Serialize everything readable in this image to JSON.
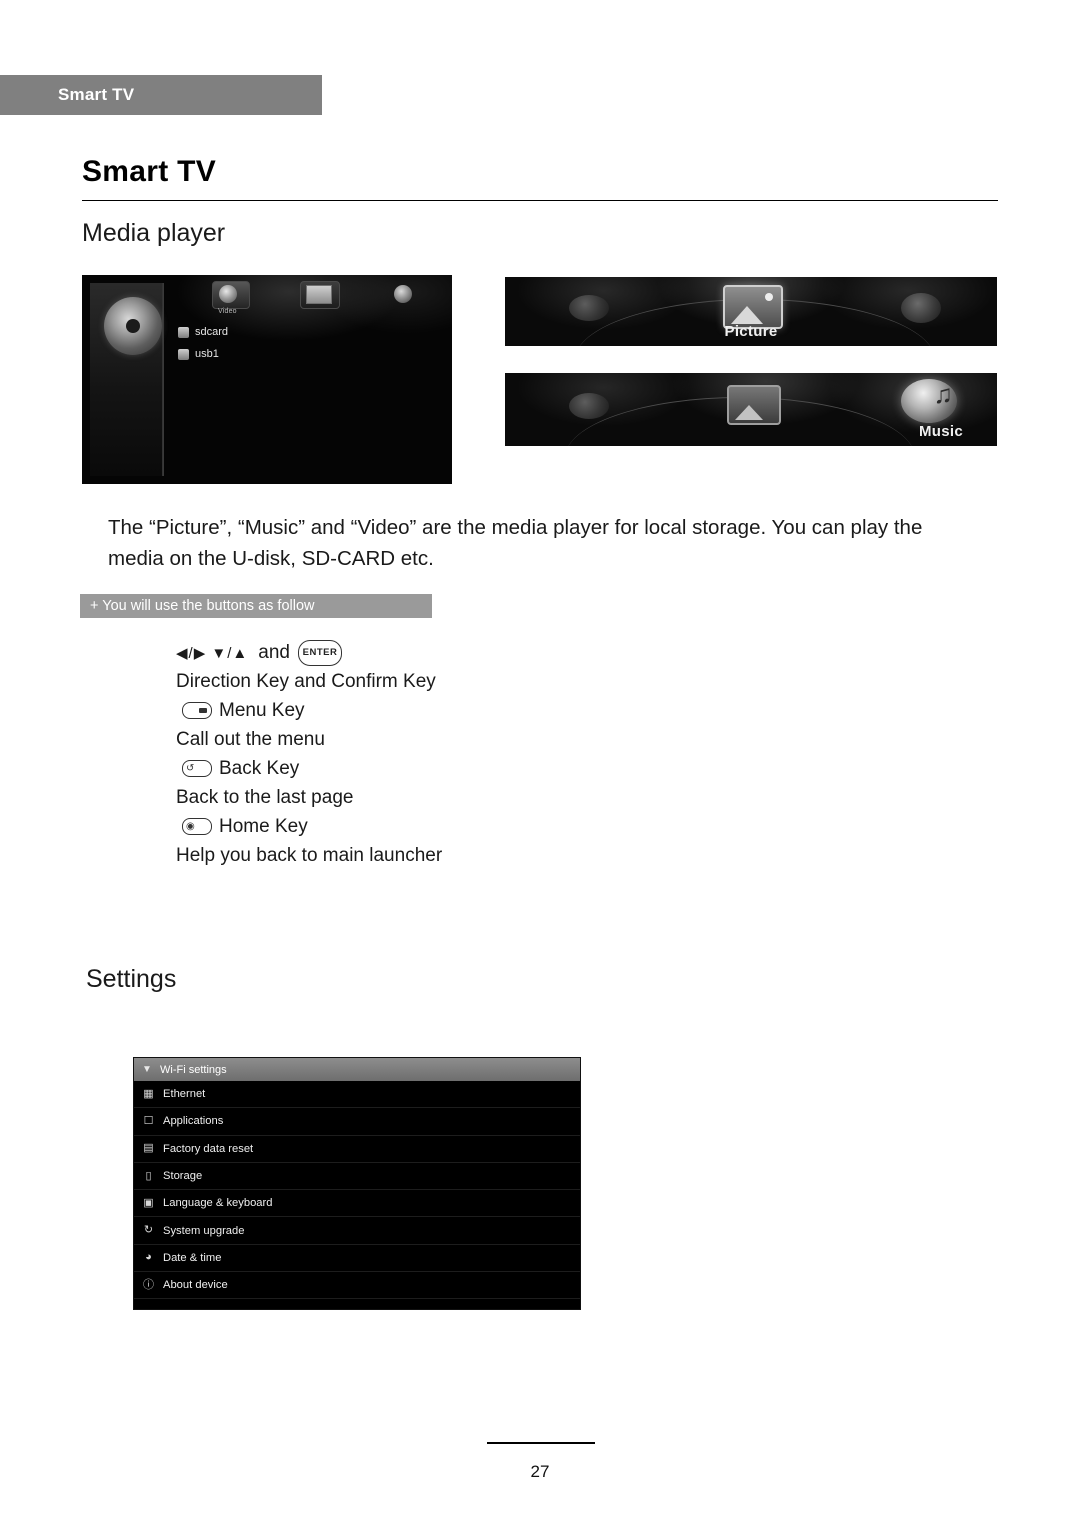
{
  "header": {
    "tab_label": "Smart TV"
  },
  "page_title": "Smart TV",
  "sections": {
    "media_player": {
      "heading": "Media player",
      "screenshots": {
        "video": {
          "tabs": [
            {
              "caption": "Video",
              "icon": "film-icon"
            },
            {
              "caption": "",
              "icon": "picture-icon"
            },
            {
              "caption": "",
              "icon": "music-icon"
            }
          ],
          "storage_items": [
            "sdcard",
            "usb1"
          ]
        },
        "picture": {
          "caption": "Picture"
        },
        "music": {
          "caption": "Music"
        }
      },
      "paragraph": "The “Picture”, “Music” and “Video” are the media player for local storage. You can play the media on the U-disk, SD-CARD etc.",
      "note_ribbon": "+ You will use the buttons as follow",
      "keys": [
        {
          "arrows": "◀/▶  ▼/▲",
          "and": "and",
          "button": "ENTER",
          "description": "Direction Key and Confirm Key"
        },
        {
          "button_icon": "menu-key-icon",
          "label": "Menu Key",
          "description": "Call out the menu"
        },
        {
          "button_icon": "back-key-icon",
          "label": "Back Key",
          "description": "Back to the last page"
        },
        {
          "button_icon": "home-key-icon",
          "label": "Home Key",
          "description": "Help you back to main launcher"
        }
      ]
    },
    "settings": {
      "heading": "Settings",
      "screenshot": {
        "title": "Wi-Fi settings",
        "title_icon": "wifi-icon",
        "rows": [
          {
            "label": "Ethernet",
            "icon": "ethernet-icon"
          },
          {
            "label": "Applications",
            "icon": "applications-icon"
          },
          {
            "label": "Factory data reset",
            "icon": "factory-reset-icon"
          },
          {
            "label": "Storage",
            "icon": "storage-icon"
          },
          {
            "label": "Language & keyboard",
            "icon": "language-icon"
          },
          {
            "label": "System upgrade",
            "icon": "upgrade-icon"
          },
          {
            "label": "Date & time",
            "icon": "clock-icon"
          },
          {
            "label": "About device",
            "icon": "info-icon"
          }
        ]
      }
    }
  },
  "footer": {
    "page_number": "27"
  },
  "colors": {
    "header_tab_bg": "#808080",
    "ribbon_bg": "#9a9a9a",
    "screenshot_bg": "#000000",
    "settings_titlebar": "#7d7d7d"
  }
}
